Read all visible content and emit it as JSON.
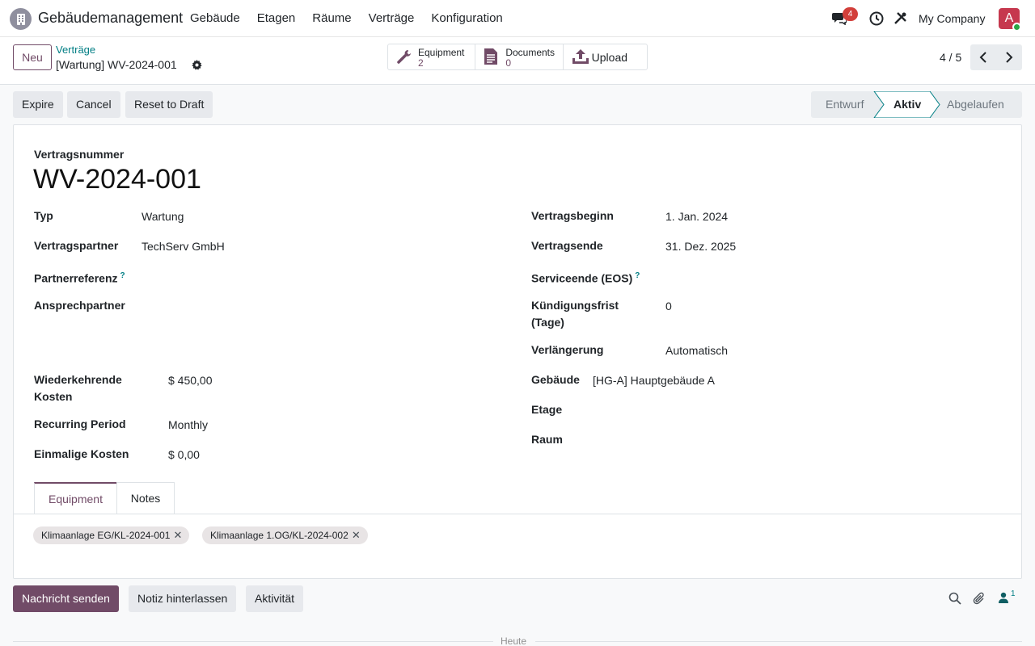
{
  "nav": {
    "app_name": "Gebäudemanagement",
    "menu": [
      "Gebäude",
      "Etagen",
      "Räume",
      "Verträge",
      "Konfiguration"
    ],
    "chat_count": "4",
    "company": "My Company",
    "avatar_letter": "A"
  },
  "control": {
    "new_label": "Neu",
    "breadcrumb_parent": "Verträge",
    "breadcrumb_current": "[Wartung] WV-2024-001",
    "smart_buttons": {
      "equipment": {
        "label": "Equipment",
        "count": "2"
      },
      "documents": {
        "label": "Documents",
        "count": "0"
      },
      "upload": {
        "label": "Upload"
      }
    },
    "pager": "4 / 5"
  },
  "status": {
    "buttons": [
      "Expire",
      "Cancel",
      "Reset to Draft"
    ],
    "stages": [
      "Entwurf",
      "Aktiv",
      "Abgelaufen"
    ],
    "active_stage": "Aktiv"
  },
  "form": {
    "number_label": "Vertragsnummer",
    "number": "WV-2024-001",
    "left": {
      "typ_label": "Typ",
      "typ": "Wartung",
      "partner_label": "Vertragspartner",
      "partner": "TechServ GmbH",
      "partner_ref_label": "Partnerreferenz",
      "contact_label": "Ansprechpartner",
      "recurring_label_1": "Wiederkehrende",
      "recurring_label_2": "Kosten",
      "recurring": "$ 450,00",
      "period_label": "Recurring Period",
      "period": "Monthly",
      "onetime_label": "Einmalige Kosten",
      "onetime": "$ 0,00"
    },
    "right": {
      "start_label": "Vertragsbeginn",
      "start": "1. Jan. 2024",
      "end_label": "Vertragsende",
      "end": "31. Dez. 2025",
      "eos_label": "Serviceende (EOS)",
      "notice_label_1": "Kündigungsfrist",
      "notice_label_2": "(Tage)",
      "notice": "0",
      "renewal_label": "Verlängerung",
      "renewal": "Automatisch",
      "building_label": "Gebäude",
      "building": "[HG-A] Hauptgebäude A",
      "floor_label": "Etage",
      "room_label": "Raum"
    },
    "help_mark": "?",
    "tabs": [
      "Equipment",
      "Notes"
    ],
    "tags": [
      "Klimaanlage EG/KL-2024-001",
      "Klimaanlage 1.OG/KL-2024-002"
    ]
  },
  "chatter": {
    "send": "Nachricht senden",
    "note": "Notiz hinterlassen",
    "activity": "Aktivität",
    "followers": "1",
    "today": "Heute"
  },
  "colors": {
    "brand": "#714b67",
    "link": "#017e84",
    "badge": "#d23f3a"
  }
}
